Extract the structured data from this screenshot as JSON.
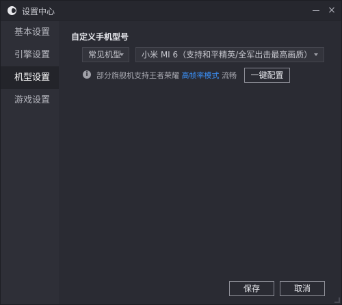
{
  "window": {
    "title": "设置中心",
    "close_label": "×"
  },
  "sidebar": {
    "items": [
      {
        "label": "基本设置"
      },
      {
        "label": "引擎设置"
      },
      {
        "label": "机型设置"
      },
      {
        "label": "游戏设置"
      }
    ],
    "active_index": 2
  },
  "model_settings": {
    "section_title": "自定义手机型号",
    "type_select": {
      "value": "常见机型"
    },
    "model_select": {
      "value": "小米 MI 6（支持和平精英/全军出击最高画质）"
    },
    "info": {
      "icon": "info-icon",
      "icon_glyph": "i",
      "text_before": "部分旗舰机支持王者荣耀",
      "link_text": "高帧率模式",
      "text_after": "流畅"
    },
    "oneclick_button": "一键配置"
  },
  "footer": {
    "save_label": "保存",
    "cancel_label": "取消"
  },
  "colors": {
    "background": "#2a2b33",
    "sidebar": "#2e2f37",
    "active_item": "#23242a",
    "link": "#3b8ff5"
  }
}
